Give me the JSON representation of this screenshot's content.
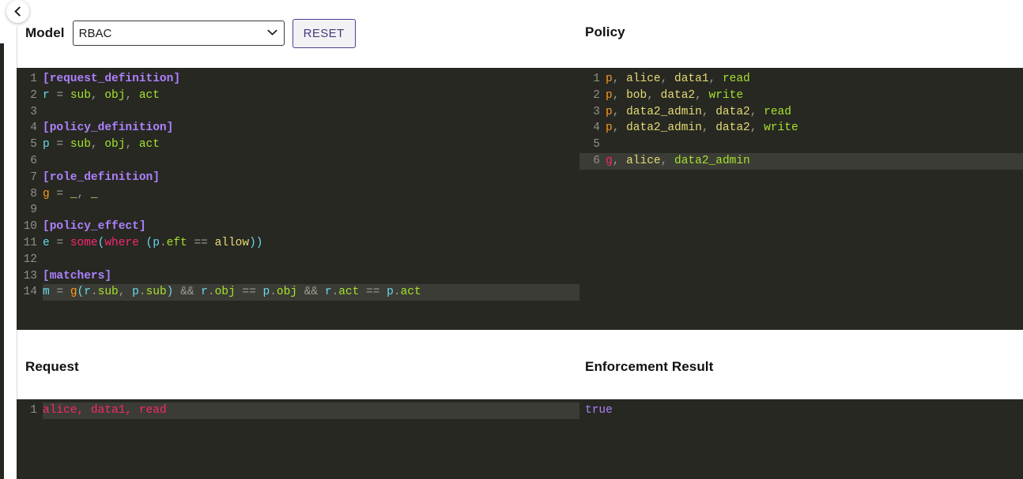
{
  "header": {
    "back_icon": "chevron-left-icon",
    "model_label": "Model",
    "model_value": "RBAC",
    "model_options": [
      "RBAC"
    ],
    "dropdown_icon": "chevron-down-icon",
    "reset_label": "RESET"
  },
  "panels": {
    "model_title": "Model",
    "policy_title": "Policy",
    "request_title": "Request",
    "result_title": "Enforcement Result"
  },
  "model_editor": {
    "active_line": 14,
    "lines": [
      {
        "n": "1",
        "text": "[request_definition]"
      },
      {
        "n": "2",
        "text": "r = sub, obj, act"
      },
      {
        "n": "3",
        "text": ""
      },
      {
        "n": "4",
        "text": "[policy_definition]"
      },
      {
        "n": "5",
        "text": "p = sub, obj, act"
      },
      {
        "n": "6",
        "text": ""
      },
      {
        "n": "7",
        "text": "[role_definition]"
      },
      {
        "n": "8",
        "text": "g = _, _"
      },
      {
        "n": "9",
        "text": ""
      },
      {
        "n": "10",
        "text": "[policy_effect]"
      },
      {
        "n": "11",
        "text": "e = some(where (p.eft == allow))"
      },
      {
        "n": "12",
        "text": ""
      },
      {
        "n": "13",
        "text": "[matchers]"
      },
      {
        "n": "14",
        "text": "m = g(r.sub, p.sub) && r.obj == p.obj && r.act == p.act"
      }
    ]
  },
  "policy_editor": {
    "active_line": 6,
    "lines": [
      {
        "n": "1",
        "text": "p, alice, data1, read"
      },
      {
        "n": "2",
        "text": "p, bob, data2, write"
      },
      {
        "n": "3",
        "text": "p, data2_admin, data2, read"
      },
      {
        "n": "4",
        "text": "p, data2_admin, data2, write"
      },
      {
        "n": "5",
        "text": ""
      },
      {
        "n": "6",
        "text": "g, alice, data2_admin"
      }
    ]
  },
  "request_editor": {
    "active_line": 1,
    "lines": [
      {
        "n": "1",
        "text": "alice, data1, read"
      }
    ]
  },
  "result_editor": {
    "value": "true"
  },
  "colors": {
    "editor_bg": "#272822",
    "active_line_bg": "#3b3c35",
    "gutter_text": "#90908a",
    "accent_purple": "#4b3f91",
    "section": "#ae81ff",
    "variable": "#66d9ef",
    "field": "#a6e22e",
    "keyword": "#f92672",
    "string": "#e6db74",
    "function": "#fd971f",
    "boolean": "#ae81ff"
  }
}
